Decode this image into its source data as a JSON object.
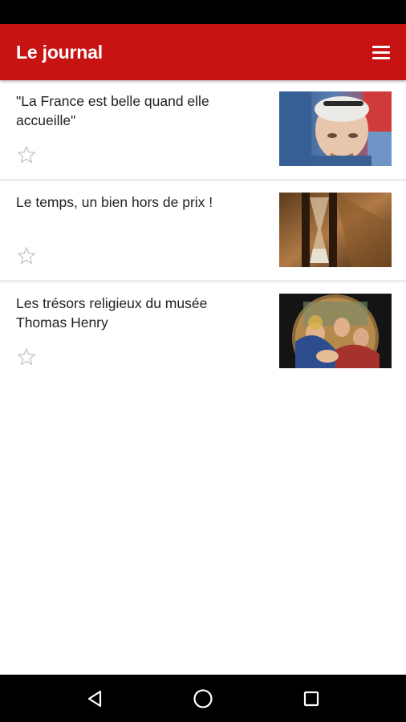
{
  "app_bar": {
    "title": "Le journal",
    "color": "#c81313",
    "menu_icon": "hamburger-menu-icon"
  },
  "articles": [
    {
      "title": "\"La France est belle quand elle accueille\"",
      "favorite_icon": "star-outline-icon",
      "thumbnail": "portrait-man-glasses"
    },
    {
      "title": "Le temps, un bien hors de prix !",
      "favorite_icon": "star-outline-icon",
      "thumbnail": "hourglass"
    },
    {
      "title": "Les trésors religieux du musée Thomas Henry",
      "favorite_icon": "star-outline-icon",
      "thumbnail": "religious-painting-tondo"
    }
  ],
  "nav_bar": {
    "back_icon": "back-triangle-icon",
    "home_icon": "home-circle-icon",
    "recents_icon": "recents-square-icon"
  }
}
